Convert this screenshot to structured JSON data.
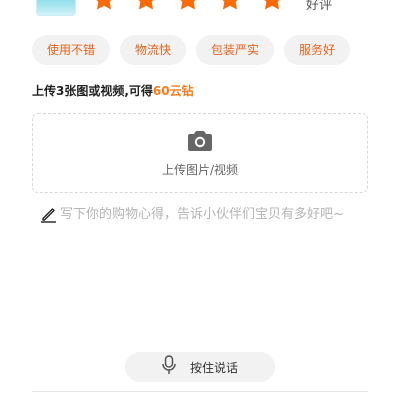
{
  "rating": {
    "stars_filled": 5,
    "stars_total": 5,
    "label": "好评",
    "star_color": "#ff6a00"
  },
  "tags": [
    {
      "label": "使用不错"
    },
    {
      "label": "物流快"
    },
    {
      "label": "包装严实"
    },
    {
      "label": "服务好"
    }
  ],
  "reward": {
    "prefix": "上传3张图或视频,可得",
    "amount": "60云钻",
    "amount_color": "#ff7a1a"
  },
  "upload": {
    "label": "上传图片/视频",
    "icon": "camera-icon"
  },
  "comment": {
    "placeholder": "写下你的购物心得，告诉小伙伴们宝贝有多好吧~",
    "icon": "pencil-icon"
  },
  "voice": {
    "label": "按住说话",
    "icon": "microphone-icon"
  },
  "colors": {
    "accent": "#ff6a00",
    "tag_text": "#e8621a",
    "tag_bg": "#f2f2f2"
  }
}
